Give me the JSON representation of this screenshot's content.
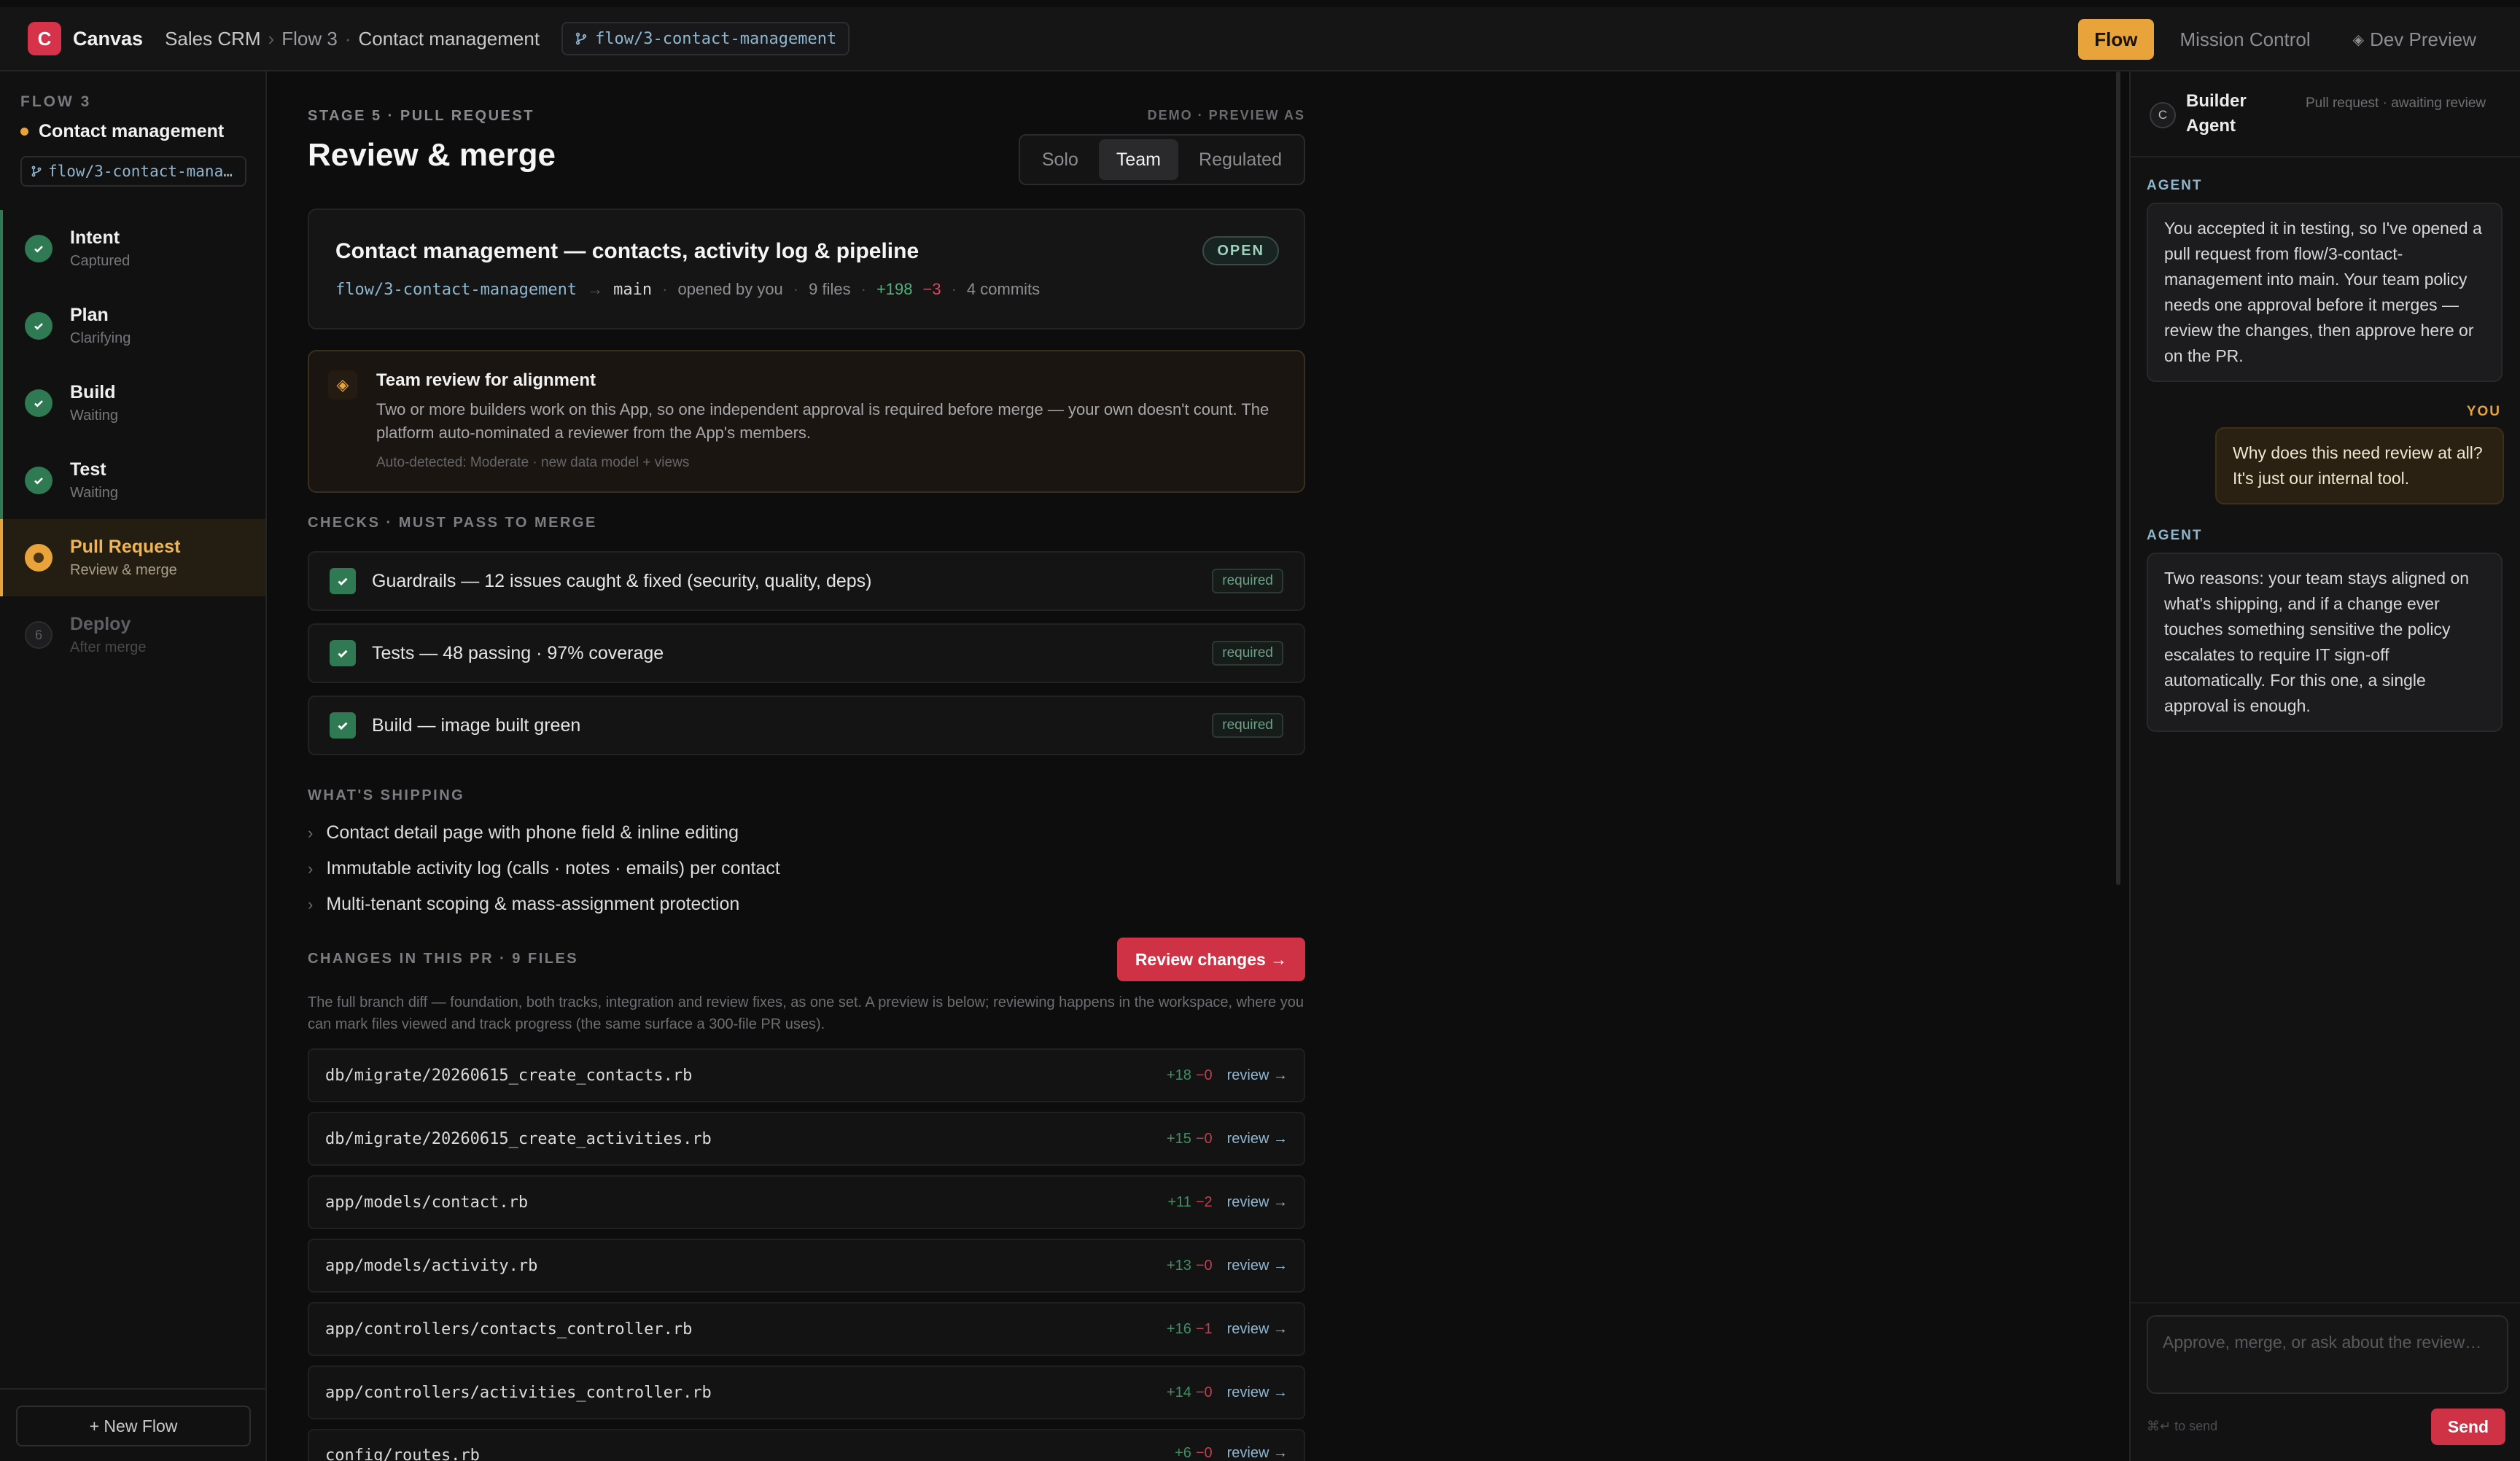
{
  "topbar": {
    "logo_letter": "C",
    "app_name": "Canvas",
    "crumbs": [
      "Sales CRM",
      "Flow 3",
      "Contact management"
    ],
    "branch": "flow/3-contact-management",
    "modes": [
      "Flow",
      "Mission Control",
      "Dev Preview"
    ],
    "active_mode": "Flow"
  },
  "sidebar": {
    "flow_label": "FLOW 3",
    "flow_title": "Contact management",
    "branch": "flow/3-contact-mana…",
    "stages": [
      {
        "name": "Intent",
        "status": "Captured",
        "state": "done"
      },
      {
        "name": "Plan",
        "status": "Clarifying",
        "state": "done"
      },
      {
        "name": "Build",
        "status": "Waiting",
        "state": "done"
      },
      {
        "name": "Test",
        "status": "Waiting",
        "state": "done"
      },
      {
        "name": "Pull Request",
        "status": "Review & merge",
        "state": "active"
      },
      {
        "name": "Deploy",
        "status": "After merge",
        "state": "pending",
        "number": "6"
      }
    ],
    "new_flow": "+ New Flow"
  },
  "main": {
    "stage_label": "STAGE 5 · PULL REQUEST",
    "demo_label": "DEMO · PREVIEW AS",
    "title": "Review & merge",
    "preview_options": [
      "Solo",
      "Team",
      "Regulated"
    ],
    "preview_active": "Team",
    "pr": {
      "title": "Contact management — contacts, activity log & pipeline",
      "badge": "OPEN",
      "source_branch": "flow/3-contact-management",
      "target_branch": "main",
      "opened_by": "opened by you",
      "files": "9 files",
      "additions": "+198",
      "deletions": "−3",
      "commits": "4 commits"
    },
    "alignment": {
      "icon": "◈",
      "title": "Team review for alignment",
      "body": "Two or more builders work on this App, so one independent approval is required before merge — your own doesn't count. The platform auto-nominated a reviewer from the App's members.",
      "footnote": "Auto-detected: Moderate · new data model + views"
    },
    "checks_label": "CHECKS · MUST PASS TO MERGE",
    "checks": [
      {
        "text": "Guardrails — 12 issues caught & fixed (security, quality, deps)",
        "tag": "required"
      },
      {
        "text": "Tests — 48 passing · 97% coverage",
        "tag": "required"
      },
      {
        "text": "Build — image built green",
        "tag": "required"
      }
    ],
    "shipping_label": "WHAT'S SHIPPING",
    "shipping": [
      "Contact detail page with phone field & inline editing",
      "Immutable activity log (calls · notes · emails) per contact",
      "Multi-tenant scoping & mass-assignment protection"
    ],
    "changes_label": "CHANGES IN THIS PR · 9 FILES",
    "review_button": "Review changes →",
    "changes_note": "The full branch diff — foundation, both tracks, integration and review fixes, as one set. A preview is below; reviewing happens in the workspace, where you can mark files viewed and track progress (the same surface a 300-file PR uses).",
    "review_link": "review →",
    "files": [
      {
        "path": "db/migrate/20260615_create_contacts.rb",
        "add": "+18",
        "del": "−0"
      },
      {
        "path": "db/migrate/20260615_create_activities.rb",
        "add": "+15",
        "del": "−0"
      },
      {
        "path": "app/models/contact.rb",
        "add": "+11",
        "del": "−2"
      },
      {
        "path": "app/models/activity.rb",
        "add": "+13",
        "del": "−0"
      },
      {
        "path": "app/controllers/contacts_controller.rb",
        "add": "+16",
        "del": "−1"
      },
      {
        "path": "app/controllers/activities_controller.rb",
        "add": "+14",
        "del": "−0"
      },
      {
        "path": "config/routes.rb",
        "add": "+6",
        "del": "−0"
      }
    ]
  },
  "chat": {
    "avatar_letter": "C",
    "agent_name": "Builder Agent",
    "agent_status": "Pull request · awaiting review",
    "messages": [
      {
        "role": "AGENT",
        "text": "You accepted it in testing, so I've opened a pull request from flow/3-contact-management into main. Your team policy needs one approval before it merges — review the changes, then approve here or on the PR."
      },
      {
        "role": "YOU",
        "text": "Why does this need review at all? It's just our internal tool."
      },
      {
        "role": "AGENT",
        "text": "Two reasons: your team stays aligned on what's shipping, and if a change ever touches something sensitive the policy escalates to require IT sign-off automatically. For this one, a single approval is enough."
      }
    ],
    "input_placeholder": "Approve, merge, or ask about the review…",
    "hint": "⌘↵ to send",
    "send": "Send"
  },
  "colors": {
    "accent": "#e8a33a",
    "brand": "#d6334a",
    "success": "#2f7a52",
    "danger": "#cf3244",
    "link": "#8fb6cf"
  }
}
